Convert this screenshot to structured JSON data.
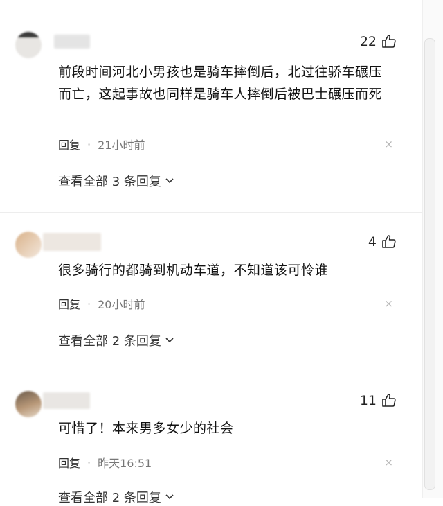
{
  "comments": [
    {
      "likes": "22",
      "text": "前段时间河北小男孩也是骑车摔倒后，北过往骄车碾压而亡，这起事故也同样是骑车人摔倒后被巴士碾压而死",
      "reply_label": "回复",
      "separator": "·",
      "time": "21小时前",
      "view_all": "查看全部 3 条回复",
      "dismiss": "×"
    },
    {
      "likes": "4",
      "text": "很多骑行的都骑到机动车道，不知道该可怜谁",
      "reply_label": "回复",
      "separator": "·",
      "time": "20小时前",
      "view_all": "查看全部 2 条回复",
      "dismiss": "×"
    },
    {
      "likes": "11",
      "text": "可惜了！本来男多女少的社会",
      "reply_label": "回复",
      "separator": "·",
      "time": "昨天16:51",
      "view_all": "查看全部 2 条回复",
      "dismiss": "×"
    }
  ],
  "icons": {
    "like": "thumbs-up-icon",
    "expand": "chevron-down-icon",
    "dismiss": "close-icon"
  }
}
